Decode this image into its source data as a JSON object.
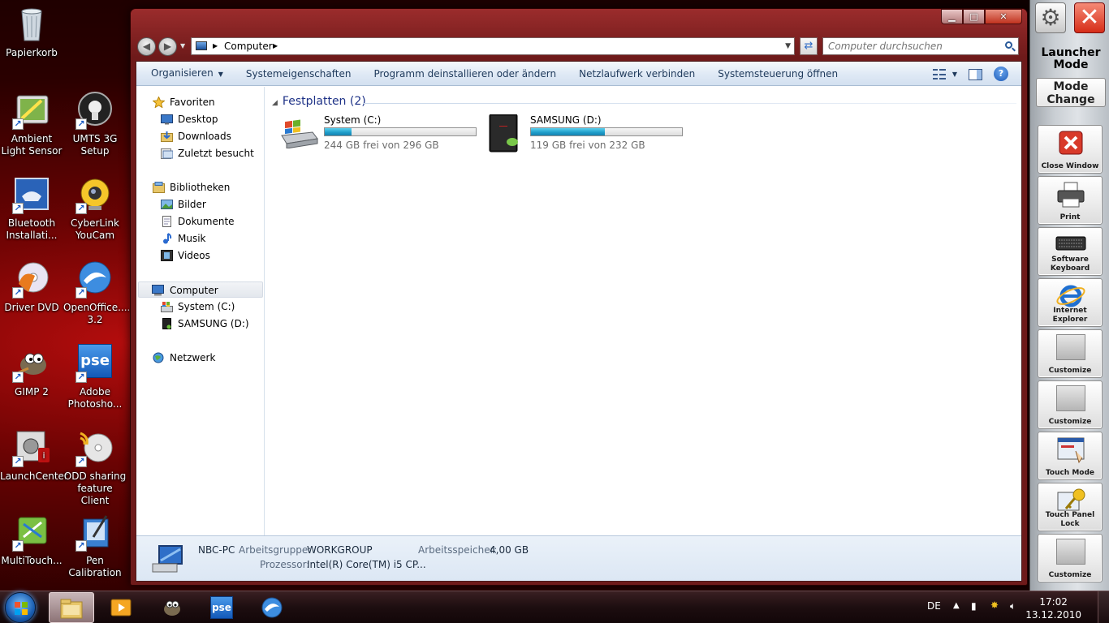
{
  "desktop": {
    "icons": [
      {
        "label": "Papierkorb"
      },
      {
        "label": "Ambient Light Sensor"
      },
      {
        "label": "UMTS 3G Setup"
      },
      {
        "label": "Bluetooth Installati..."
      },
      {
        "label": "CyberLink YouCam"
      },
      {
        "label": "Driver DVD"
      },
      {
        "label": "OpenOffice.... 3.2"
      },
      {
        "label": "GIMP 2"
      },
      {
        "label": "Adobe Photosho..."
      },
      {
        "label": "LaunchCenter"
      },
      {
        "label": "ODD sharing feature Client"
      },
      {
        "label": "MultiTouch..."
      },
      {
        "label": "Pen Calibration"
      }
    ],
    "pse_logo": "pse"
  },
  "window": {
    "controls": {
      "minimize": "▁",
      "maximize": "□",
      "close": "✕"
    },
    "address": {
      "crumb": "Computer"
    },
    "search": {
      "placeholder": "Computer durchsuchen"
    },
    "commandbar": {
      "organize": "Organisieren",
      "items": [
        "Systemeigenschaften",
        "Programm deinstallieren oder ändern",
        "Netzlaufwerk verbinden",
        "Systemsteuerung öffnen"
      ],
      "help": "?"
    },
    "navpane": {
      "favorites": "Favoriten",
      "desktop": "Desktop",
      "downloads": "Downloads",
      "recent": "Zuletzt besucht",
      "libraries": "Bibliotheken",
      "pictures": "Bilder",
      "documents": "Dokumente",
      "music": "Musik",
      "videos": "Videos",
      "computer": "Computer",
      "system_c": "System (C:)",
      "samsung_d": "SAMSUNG (D:)",
      "network": "Netzwerk"
    },
    "content": {
      "group_title": "Festplatten (2)",
      "drives": [
        {
          "name": "System (C:)",
          "free_text": "244 GB frei von 296 GB",
          "used_fraction": 0.176
        },
        {
          "name": "SAMSUNG (D:)",
          "free_text": "119 GB frei von 232 GB",
          "used_fraction": 0.487
        }
      ]
    },
    "details": {
      "pc_name": "NBC-PC",
      "workgroup_label": "Arbeitsgruppe:",
      "workgroup_value": "WORKGROUP",
      "memory_label": "Arbeitsspeicher:",
      "memory_value": "4,00 GB",
      "cpu_label": "Prozessor:",
      "cpu_value": "Intel(R) Core(TM) i5 CP..."
    }
  },
  "launcher": {
    "gear": "⚙",
    "close": "✕",
    "title": "Launcher Mode",
    "mode_change": "Mode Change",
    "buttons": [
      {
        "label": "Close Window"
      },
      {
        "label": "Print"
      },
      {
        "label": "Software Keyboard"
      },
      {
        "label": "Internet Explorer"
      },
      {
        "label": "Customize"
      },
      {
        "label": "Customize"
      },
      {
        "label": "Touch Mode"
      },
      {
        "label": "Touch Panel Lock"
      },
      {
        "label": "Customize"
      }
    ]
  },
  "taskbar": {
    "language": "DE",
    "time": "17:02",
    "date": "13.12.2010",
    "pse_label": "pse"
  },
  "colors": {
    "accent": "#1e3287",
    "drive_bar": "#1e9cc8",
    "desktop_red": "#b50d0d"
  }
}
